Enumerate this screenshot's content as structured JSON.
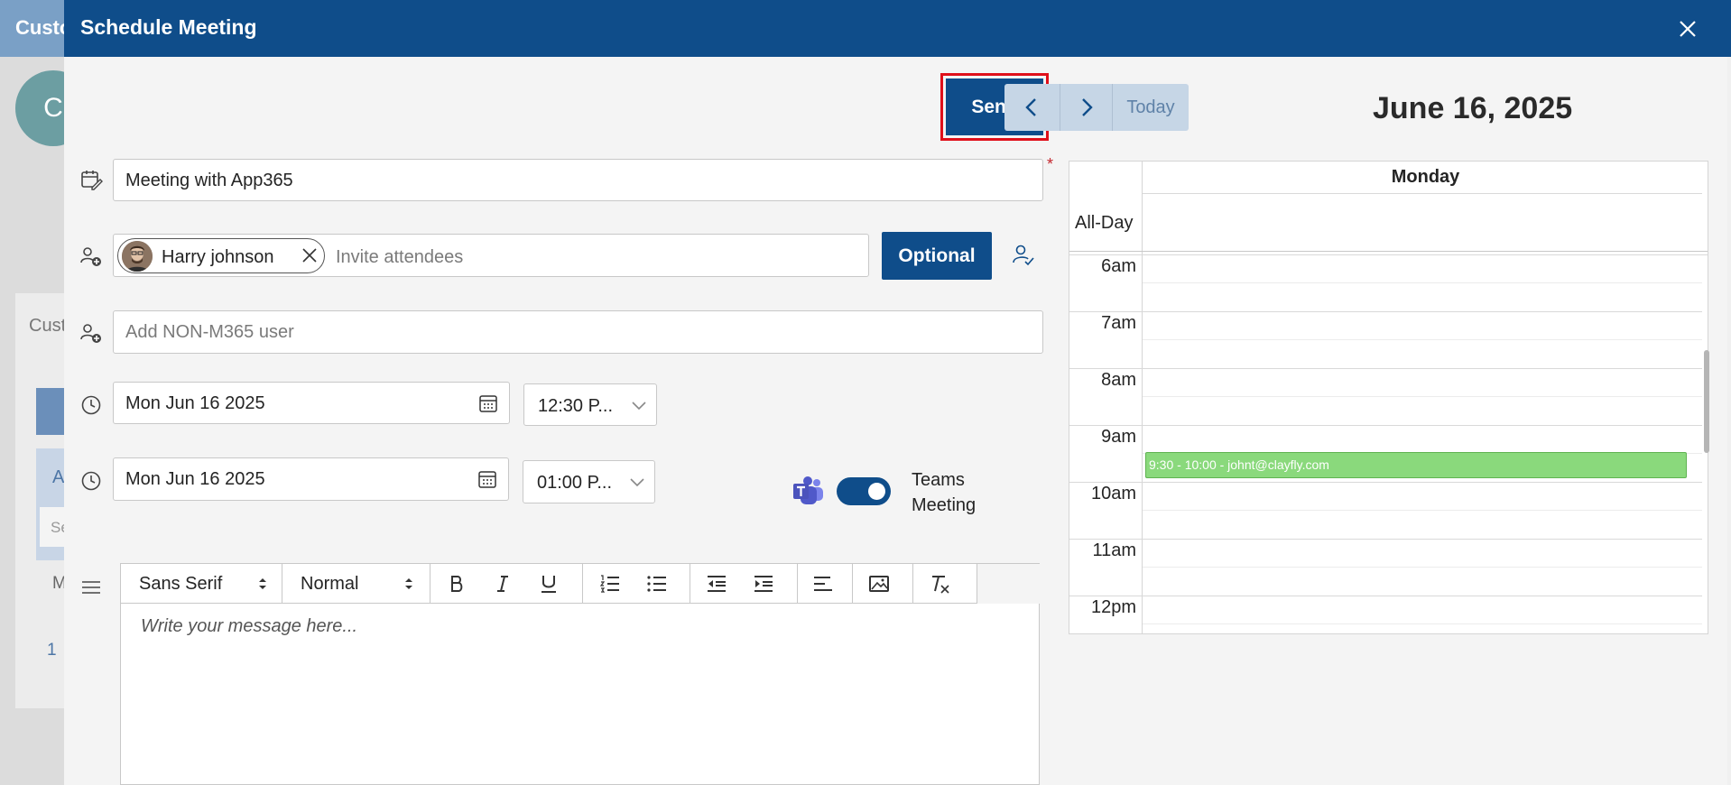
{
  "background": {
    "header_title": "Custo",
    "avatar_letter": "C",
    "cust_label": "Cust",
    "a_label": "A",
    "search_stub": "Se",
    "m_label": "M",
    "page_stub": "1"
  },
  "modal": {
    "title": "Schedule Meeting",
    "send_label": "Send",
    "subject_value": "Meeting with App365",
    "required_mark": "*",
    "attendee_name": "Harry johnson",
    "invite_placeholder": "Invite attendees",
    "optional_label": "Optional",
    "non_m365_placeholder": "Add NON-M365 user",
    "start_date": "Mon Jun 16 2025",
    "start_time": "12:30 P...",
    "end_date": "Mon Jun 16 2025",
    "end_time": "01:00 P...",
    "teams_label_line1": "Teams",
    "teams_label_line2": "Meeting",
    "teams_meeting_enabled": true,
    "editor": {
      "font_family": "Sans Serif",
      "font_size": "Normal",
      "placeholder": "Write your message here..."
    }
  },
  "calendar": {
    "today_label": "Today",
    "date_title": "June 16, 2025",
    "day_header": "Monday",
    "allday_label": "All-Day",
    "hours": [
      "6am",
      "7am",
      "8am",
      "9am",
      "10am",
      "11am",
      "12pm"
    ],
    "events": [
      {
        "label": "9:30 - 10:00 - johnt@clayfly.com",
        "color": "#8ad97c"
      }
    ]
  },
  "colors": {
    "brand": "#0f4d8a",
    "highlight": "#e0101a",
    "event": "#8ad97c"
  }
}
